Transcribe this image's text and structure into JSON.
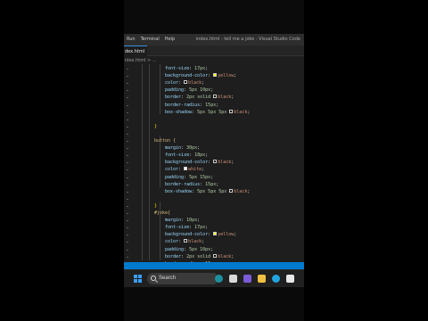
{
  "window": {
    "menu": [
      "Run",
      "Terminal",
      "Help"
    ],
    "title": "index.html - tell me a joke - Visual Studio Code"
  },
  "tab": {
    "active_label": "dex.html"
  },
  "breadcrumb": "idex.html > ...",
  "code": {
    "block1": [
      {
        "prop": "font-size",
        "value": "17px"
      },
      {
        "prop": "background-color",
        "value": "yellow",
        "swatch": "#ffff00"
      },
      {
        "prop": "color",
        "value": "black",
        "swatch": "#000000"
      },
      {
        "prop": "padding",
        "value": "5px 10px"
      },
      {
        "prop": "border",
        "value": "2px solid",
        "value2": "black",
        "swatch": "#000000"
      },
      {
        "prop": "border-radius",
        "value": "15px"
      },
      {
        "prop": "box-shadow",
        "value": "5px 5px 5px",
        "value2": "black",
        "swatch": "#000000"
      }
    ],
    "close1": "}",
    "button_selector": "button {",
    "block2": [
      {
        "prop": "margin",
        "value": "30px"
      },
      {
        "prop": "font-size",
        "value": "18px"
      },
      {
        "prop": "background-color",
        "value": "black",
        "swatch": "#000000"
      },
      {
        "prop": "color",
        "value": "white",
        "swatch": "#ffffff"
      },
      {
        "prop": "padding",
        "value": "5px 15px"
      },
      {
        "prop": "border-radius",
        "value": "15px"
      },
      {
        "prop": "box-shadow",
        "value": "5px 5px 5px",
        "value2": "black",
        "swatch": "#000000"
      }
    ],
    "close2": "}",
    "joke_selector": "#joke{",
    "block3": [
      {
        "prop": "margin",
        "value": "10px"
      },
      {
        "prop": "font-size",
        "value": "17px"
      },
      {
        "prop": "background-color",
        "value": "yellow",
        "swatch": "#ffff00"
      },
      {
        "prop": "color",
        "value": "black",
        "swatch": "#000000"
      },
      {
        "prop": "padding",
        "value": "5px 10px"
      },
      {
        "prop": "border",
        "value": "2px solid",
        "value2": "black",
        "swatch": "#000000"
      },
      {
        "prop": "border-radius",
        "value": "15px"
      },
      {
        "prop": "box-shadow",
        "value": "5px 5px 5px",
        "value2": "black",
        "swatch": "#000000"
      }
    ]
  },
  "taskbar": {
    "search_label": "Search",
    "icons": [
      "windows-start",
      "search",
      "copilot",
      "task-view",
      "chat",
      "file-explorer",
      "edge",
      "store",
      "vscode"
    ]
  },
  "colors": {
    "editor_bg": "#1e1e1e",
    "property": "#9cdcfe",
    "value_keyword": "#ce9178",
    "number": "#b5cea8",
    "selector": "#d7ba7d",
    "brace": "#ffd700",
    "statusbar": "#007acc",
    "taskbar_bg": "#202020"
  }
}
